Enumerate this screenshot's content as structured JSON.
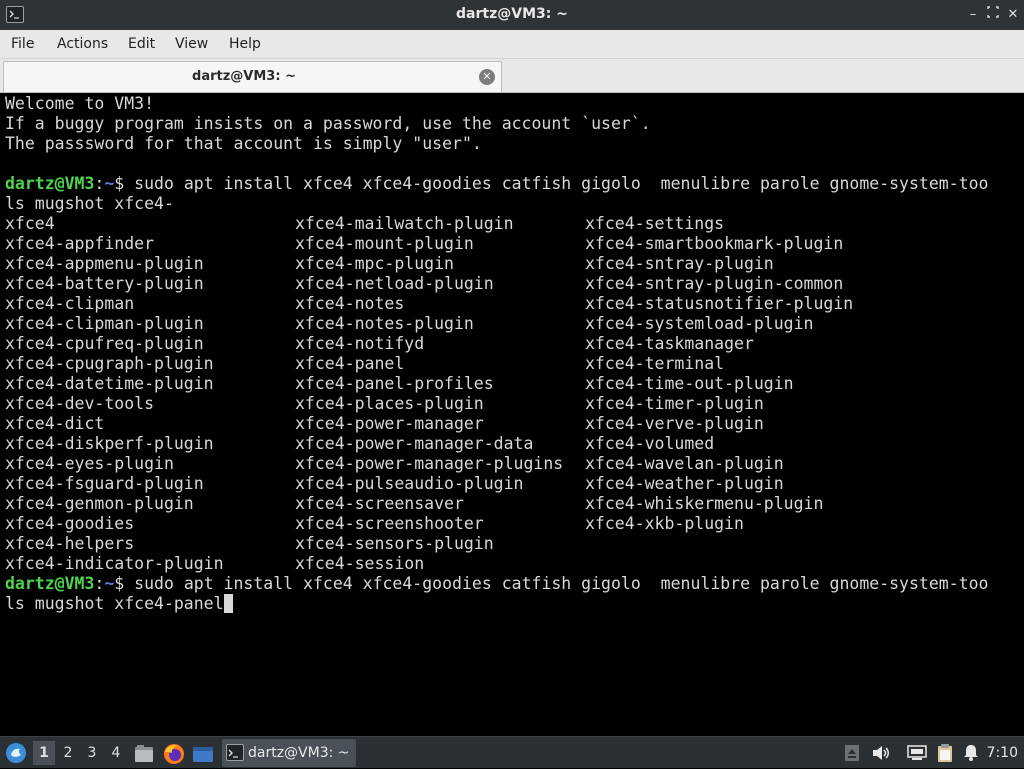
{
  "window": {
    "title": "dartz@VM3: ~",
    "buttons": {
      "minimize": "–",
      "maximize": "□",
      "close": "✕"
    }
  },
  "menubar": {
    "items": [
      "File",
      "Actions",
      "Edit",
      "View",
      "Help"
    ]
  },
  "tabs": [
    {
      "label": "dartz@VM3: ~",
      "close_icon": "close-icon"
    }
  ],
  "terminal": {
    "welcome": [
      "Welcome to VM3!",
      "If a buggy program insists on a password, use the account `user`.",
      "The passsword for that account is simply \"user\"."
    ],
    "prompt": {
      "user": "dartz@VM3",
      "sep": ":",
      "path": "~",
      "sym": "$ "
    },
    "command1_a": "sudo apt install xfce4 xfce4-goodies catfish gigolo  menulibre parole gnome-system-too",
    "command1_b": "ls mugshot xfce4-",
    "completions": [
      [
        "xfce4",
        "xfce4-mailwatch-plugin",
        "xfce4-settings"
      ],
      [
        "xfce4-appfinder",
        "xfce4-mount-plugin",
        "xfce4-smartbookmark-plugin"
      ],
      [
        "xfce4-appmenu-plugin",
        "xfce4-mpc-plugin",
        "xfce4-sntray-plugin"
      ],
      [
        "xfce4-battery-plugin",
        "xfce4-netload-plugin",
        "xfce4-sntray-plugin-common"
      ],
      [
        "xfce4-clipman",
        "xfce4-notes",
        "xfce4-statusnotifier-plugin"
      ],
      [
        "xfce4-clipman-plugin",
        "xfce4-notes-plugin",
        "xfce4-systemload-plugin"
      ],
      [
        "xfce4-cpufreq-plugin",
        "xfce4-notifyd",
        "xfce4-taskmanager"
      ],
      [
        "xfce4-cpugraph-plugin",
        "xfce4-panel",
        "xfce4-terminal"
      ],
      [
        "xfce4-datetime-plugin",
        "xfce4-panel-profiles",
        "xfce4-time-out-plugin"
      ],
      [
        "xfce4-dev-tools",
        "xfce4-places-plugin",
        "xfce4-timer-plugin"
      ],
      [
        "xfce4-dict",
        "xfce4-power-manager",
        "xfce4-verve-plugin"
      ],
      [
        "xfce4-diskperf-plugin",
        "xfce4-power-manager-data",
        "xfce4-volumed"
      ],
      [
        "xfce4-eyes-plugin",
        "xfce4-power-manager-plugins",
        "xfce4-wavelan-plugin"
      ],
      [
        "xfce4-fsguard-plugin",
        "xfce4-pulseaudio-plugin",
        "xfce4-weather-plugin"
      ],
      [
        "xfce4-genmon-plugin",
        "xfce4-screensaver",
        "xfce4-whiskermenu-plugin"
      ],
      [
        "xfce4-goodies",
        "xfce4-screenshooter",
        "xfce4-xkb-plugin"
      ],
      [
        "xfce4-helpers",
        "xfce4-sensors-plugin",
        ""
      ],
      [
        "xfce4-indicator-plugin",
        "xfce4-session",
        ""
      ]
    ],
    "command2_a": "sudo apt install xfce4 xfce4-goodies catfish gigolo  menulibre parole gnome-system-too",
    "command2_b": "ls mugshot xfce4-panel"
  },
  "panel": {
    "workspaces": [
      "1",
      "2",
      "3",
      "4"
    ],
    "active_workspace": "1",
    "launchers": [
      "file-manager-icon",
      "firefox-icon",
      "desktop-icon"
    ],
    "task_label": "dartz@VM3: ~",
    "tray_icons": [
      "eject-icon",
      "volume-icon",
      "network-icon",
      "clipboard-icon",
      "notification-icon"
    ],
    "clock": "7:10"
  },
  "colors": {
    "prompt_user": "#4fd24f",
    "prompt_path": "#5c7fd6",
    "terminal_bg": "#000000",
    "terminal_fg": "#d8d8d8"
  }
}
